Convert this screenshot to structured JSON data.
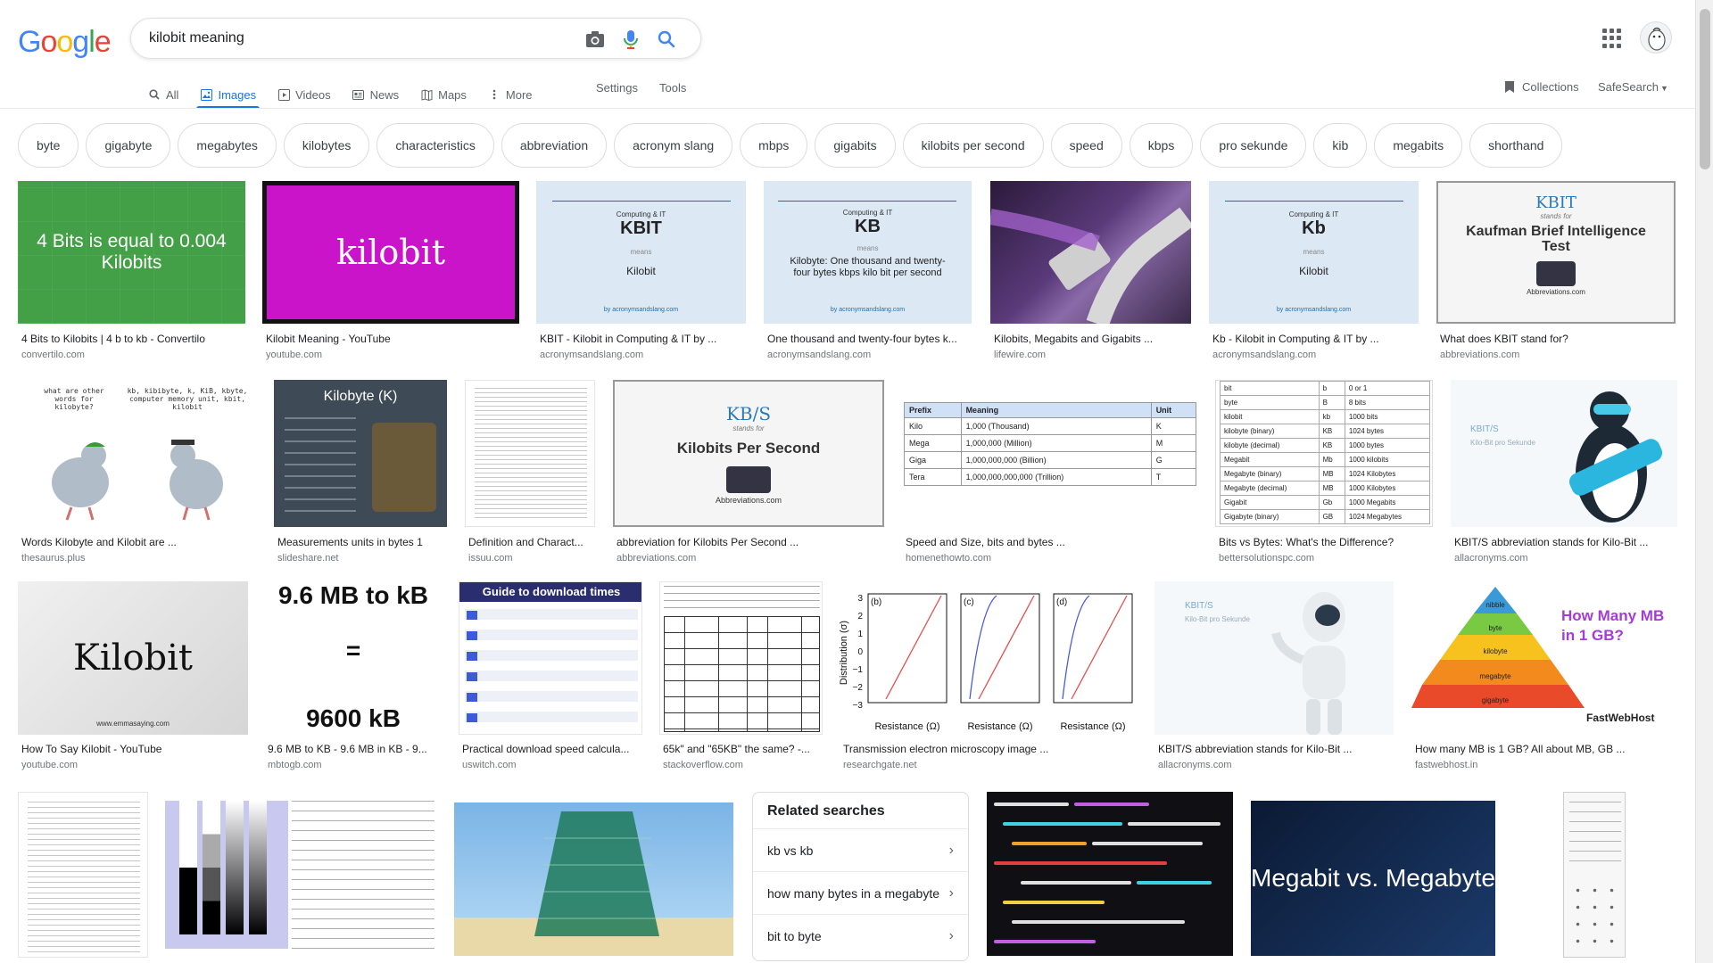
{
  "logo": {
    "letters": [
      "G",
      "o",
      "o",
      "g",
      "l",
      "e"
    ],
    "colors": [
      "#4285f4",
      "#ea4335",
      "#fbbc05",
      "#4285f4",
      "#34a853",
      "#ea4335"
    ]
  },
  "search": {
    "query": "kilobit meaning"
  },
  "tabs": [
    {
      "label": "All",
      "icon": "search-icon"
    },
    {
      "label": "Images",
      "icon": "image-icon",
      "active": true
    },
    {
      "label": "Videos",
      "icon": "video-icon"
    },
    {
      "label": "News",
      "icon": "news-icon"
    },
    {
      "label": "Maps",
      "icon": "map-icon"
    },
    {
      "label": "More",
      "icon": "more-vert-icon"
    }
  ],
  "settings_label": "Settings",
  "tools_label": "Tools",
  "collections_label": "Collections",
  "safesearch_label": "SafeSearch",
  "chips": [
    "byte",
    "gigabyte",
    "megabytes",
    "kilobytes",
    "characteristics",
    "abbreviation",
    "acronym slang",
    "mbps",
    "gigabits",
    "kilobits per second",
    "speed",
    "kbps",
    "pro sekunde",
    "kib",
    "megabits",
    "shorthand"
  ],
  "row1": [
    {
      "title": "4 Bits to Kilobits | 4 b to kb - Convertilo",
      "source": "convertilo.com",
      "thumb_text": "4 Bits is equal to 0.004 Kilobits"
    },
    {
      "title": "Kilobit Meaning - YouTube",
      "source": "youtube.com",
      "thumb_text": "kilobit"
    },
    {
      "title": "KBIT - Kilobit in Computing & IT by ...",
      "source": "acronymsandslang.com",
      "thumb_small": "Computing & IT",
      "thumb_big": "KBIT",
      "thumb_means": "means",
      "thumb_def": "Kilobit",
      "thumb_by": "by acronymsandslang.com"
    },
    {
      "title": "One thousand and twenty-four bytes k...",
      "source": "acronymsandslang.com",
      "thumb_small": "Computing & IT",
      "thumb_big": "KB",
      "thumb_means": "means",
      "thumb_def": "Kilobyte: One thousand and twenty-four bytes kbps kilo bit per second",
      "thumb_by": "by acronymsandslang.com"
    },
    {
      "title": "Kilobits, Megabits and Gigabits ...",
      "source": "lifewire.com"
    },
    {
      "title": "Kb - Kilobit in Computing & IT by ...",
      "source": "acronymsandslang.com",
      "thumb_small": "Computing & IT",
      "thumb_big": "Kb",
      "thumb_means": "means",
      "thumb_def": "Kilobit",
      "thumb_by": "by acronymsandslang.com"
    },
    {
      "title": "What does KBIT stand for?",
      "source": "abbreviations.com",
      "thumb_big": "KBIT",
      "thumb_stands": "stands for",
      "thumb_def": "Kaufman Brief Intelligence Test",
      "thumb_by": "Abbreviations.com"
    }
  ],
  "row2": [
    {
      "title": "Words Kilobyte and Kilobit are ...",
      "source": "thesaurus.plus",
      "bubble1": "what are other words for kilobyte?",
      "bubble2": "kb, kibibyte, k, KiB, kbyte, computer memory unit, kbit, kilobit"
    },
    {
      "title": "Measurements units in bytes 1",
      "source": "slideshare.net",
      "thumb_big": "Kilobyte (K)"
    },
    {
      "title": "Definition and Charact...",
      "source": "issuu.com"
    },
    {
      "title": "abbreviation for Kilobits Per Second ...",
      "source": "abbreviations.com",
      "thumb_big": "KB/S",
      "thumb_stands": "stands for",
      "thumb_def": "Kilobits Per Second",
      "thumb_by": "Abbreviations.com"
    },
    {
      "title": "Speed and Size, bits and bytes ...",
      "source": "homenethowto.com",
      "table_header": [
        "Prefix",
        "Meaning",
        "Unit"
      ],
      "table_rows": [
        [
          "Kilo",
          "1,000 (Thousand)",
          "K"
        ],
        [
          "Mega",
          "1,000,000 (Million)",
          "M"
        ],
        [
          "Giga",
          "1,000,000,000 (Billion)",
          "G"
        ],
        [
          "Tera",
          "1,000,000,000,000 (Trillion)",
          "T"
        ]
      ]
    },
    {
      "title": "Bits vs Bytes: What's the Difference?",
      "source": "bettersolutionspc.com",
      "table_rows": [
        [
          "bit",
          "b",
          "0 or 1"
        ],
        [
          "byte",
          "B",
          "8 bits"
        ],
        [
          "kilobit",
          "kb",
          "1000 bits"
        ],
        [
          "kilobyte (binary)",
          "KB",
          "1024 bytes"
        ],
        [
          "kilobyte (decimal)",
          "KB",
          "1000 bytes"
        ],
        [
          "Megabit",
          "Mb",
          "1000 kilobits"
        ],
        [
          "Megabyte (binary)",
          "MB",
          "1024 Kilobytes"
        ],
        [
          "Megabyte (decimal)",
          "MB",
          "1000 Kilobytes"
        ],
        [
          "Gigabit",
          "Gb",
          "1000 Megabits"
        ],
        [
          "Gigabyte (binary)",
          "GB",
          "1024 Megabytes"
        ]
      ]
    },
    {
      "title": "KBIT/S abbreviation stands for Kilo-Bit ...",
      "source": "allacronyms.com",
      "thumb_big": "KBIT/S",
      "thumb_def": "Kilo-Bit pro Sekunde"
    }
  ],
  "row3": [
    {
      "title": "How To Say Kilobit - YouTube",
      "source": "youtube.com",
      "thumb_big": "Kilobit",
      "thumb_by": "www.emmasaying.com"
    },
    {
      "title": "9.6 MB to KB - 9.6 MB in KB - 9...",
      "source": "mbtogb.com",
      "line1": "9.6 MB to kB",
      "line2": "=",
      "line3": "9600 kB"
    },
    {
      "title": "Practical download speed calcula...",
      "source": "uswitch.com",
      "thumb_big": "Guide to download times"
    },
    {
      "title": "65k\" and \"65KB\" the same? -...",
      "source": "stackoverflow.com"
    },
    {
      "title": "Transmission electron microscopy image ...",
      "source": "researchgate.net",
      "panels": [
        "(b)",
        "(c)",
        "(d)"
      ],
      "ylabel": "Distribution (σ)",
      "xlabel": "Resistance (Ω)",
      "yticks": [
        "3",
        "2",
        "1",
        "0",
        "−1",
        "−2",
        "−3"
      ]
    },
    {
      "title": "KBIT/S abbreviation stands for Kilo-Bit ...",
      "source": "allacronyms.com",
      "thumb_big": "KBIT/S",
      "thumb_def": "Kilo-Bit pro Sekunde"
    },
    {
      "title": "How many MB is 1 GB? All about MB, GB ...",
      "source": "fastwebhost.in",
      "thumb_big": "How Many MB in 1 GB?",
      "pyramid": [
        "nibble",
        "byte",
        "kilobyte",
        "megabyte",
        "gigabyte"
      ],
      "brand": "FastWebHost"
    }
  ],
  "row4": [
    {
      "thumb_big": ""
    },
    {},
    {},
    {},
    {
      "thumb_big": "Megabit vs. Megabyte"
    },
    {}
  ],
  "related": {
    "title": "Related searches",
    "items": [
      "kb vs kb",
      "how many bytes in a megabyte",
      "bit to byte"
    ]
  }
}
